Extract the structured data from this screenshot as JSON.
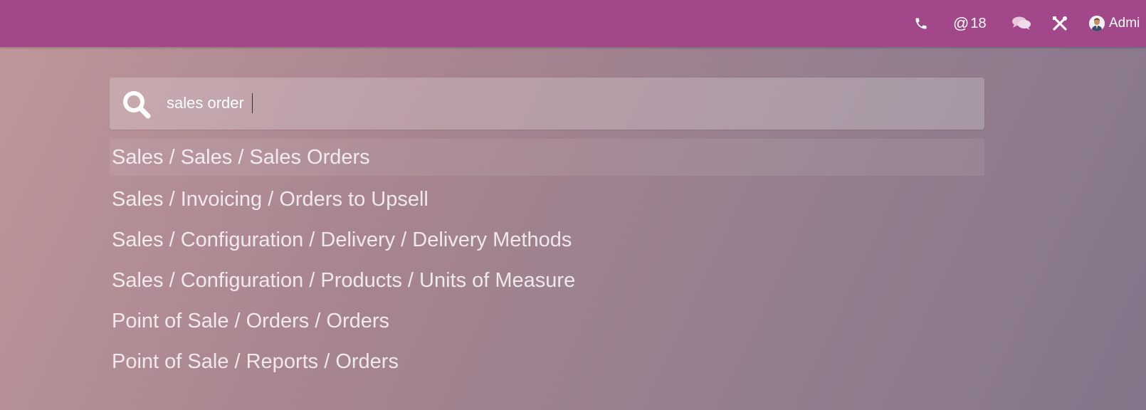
{
  "topbar": {
    "color": "#a1478a",
    "systray": {
      "phone_icon": "phone-icon",
      "mentions": {
        "symbol": "@",
        "count": "18"
      },
      "chat_icon": "chat-bubbles-icon",
      "tools_icon": "tools-icon",
      "user": {
        "name": "Admi",
        "avatar": "user-avatar"
      }
    }
  },
  "search": {
    "icon": "search-icon",
    "value": "sales order",
    "placeholder": ""
  },
  "results": [
    {
      "label": "Sales / Sales / Sales Orders",
      "active": true
    },
    {
      "label": "Sales / Invoicing / Orders to Upsell",
      "active": false
    },
    {
      "label": "Sales / Configuration / Delivery / Delivery Methods",
      "active": false
    },
    {
      "label": "Sales / Configuration / Products / Units of Measure",
      "active": false
    },
    {
      "label": "Point of Sale / Orders / Orders",
      "active": false
    },
    {
      "label": "Point of Sale / Reports / Orders",
      "active": false
    }
  ]
}
